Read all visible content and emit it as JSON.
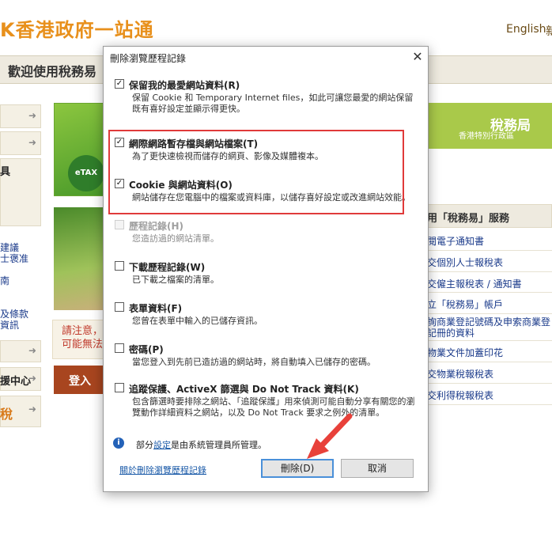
{
  "site": {
    "logo_letter": "K",
    "logo_text1": "香港政府",
    "logo_text2": "一站通",
    "lang_link": "English",
    "lang_link2": "新",
    "welcome": "歡迎使用稅務易",
    "side": {
      "item_black": "具",
      "link1": "建議\n士褒准",
      "link2": "南",
      "link3": "及條款\n資訊",
      "help_center": "援中心",
      "tax": "稅"
    },
    "etax_badge": "稅\neTAX",
    "notice": "請注意，\n可能無法",
    "login": "登入",
    "ird": {
      "title": "稅務局",
      "subtitle": "香港特別行政區"
    },
    "services": {
      "header": "用「稅務易」服務",
      "items": [
        "閱電子通知書",
        "交個別人士報稅表",
        "交僱主報稅表 / 通知書",
        "立「稅務易」帳戶",
        "詢商業登記號碼及申索商業登記冊的資料",
        "物業文件加蓋印花",
        "交物業稅報稅表",
        "交利得稅報稅表"
      ]
    }
  },
  "dialog": {
    "title": "刪除瀏覽歷程記錄",
    "close_glyph": "✕",
    "options": [
      {
        "label": "保留我的最愛網站資料(R)",
        "desc": "保留 Cookie 和 Temporary Internet files，如此可讓您最愛的網站保留既有喜好設定並顯示得更快。",
        "checked": true,
        "enabled": true
      },
      {
        "label": "網際網路暫存檔與網站檔案(T)",
        "desc": "為了更快速檢視而儲存的網頁、影像及媒體複本。",
        "checked": true,
        "enabled": true
      },
      {
        "label": "Cookie 與網站資料(O)",
        "desc": "網站儲存在您電腦中的檔案或資料庫，以儲存喜好設定或改進網站效能。",
        "checked": true,
        "enabled": true
      },
      {
        "label": "歷程記錄(H)",
        "desc": "您造訪過的網站清單。",
        "checked": false,
        "enabled": false
      },
      {
        "label": "下載歷程記錄(W)",
        "desc": "已下載之檔案的清單。",
        "checked": false,
        "enabled": true
      },
      {
        "label": "表單資料(F)",
        "desc": "您曾在表單中輸入的已儲存資訊。",
        "checked": false,
        "enabled": true
      },
      {
        "label": "密碼(P)",
        "desc": "當您登入到先前已造訪過的網站時，將自動填入已儲存的密碼。",
        "checked": false,
        "enabled": true
      },
      {
        "label": "追蹤保護、ActiveX 篩選與 Do Not Track 資料(K)",
        "desc": "包含篩選時要排除之網站、「追蹤保護」用來偵測可能自動分享有關您的瀏覽動作詳細資料之網站，以及 Do Not Track 要求之例外的清單。",
        "checked": false,
        "enabled": true
      }
    ],
    "info_prefix": "部分",
    "info_link": "設定",
    "info_suffix": "是由系統管理員所管理。",
    "about_link": "關於刪除瀏覽歷程記錄",
    "delete_button": "刪除(D)",
    "cancel_button": "取消",
    "check_glyph": "✓",
    "highlight_color": "#e03a3a",
    "arrow_color": "#e8413a"
  }
}
